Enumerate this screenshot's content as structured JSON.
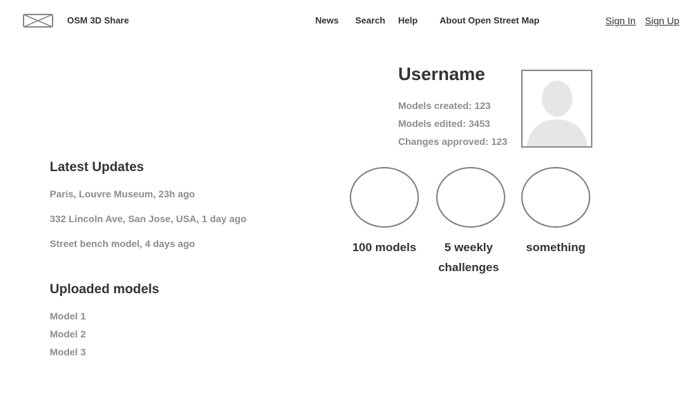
{
  "header": {
    "brand": "OSM 3D Share",
    "logo_icon": "image-placeholder-icon",
    "nav": [
      "News",
      "Search",
      "Help",
      "About Open Street Map"
    ],
    "sign_in": "Sign In",
    "sign_up": "Sign Up"
  },
  "profile": {
    "username": "Username",
    "stats": [
      "Models created: 123",
      "Models edited: 3453",
      "Changes approved: 123"
    ],
    "avatar_icon": "user-avatar-icon"
  },
  "badges": [
    {
      "label": "100 models"
    },
    {
      "label": "5 weekly challenges"
    },
    {
      "label": "something"
    }
  ],
  "latest_updates": {
    "title": "Latest Updates",
    "items": [
      "Paris, Louvre Museum, 23h ago",
      "332 Lincoln Ave, San Jose, USA, 1 day ago",
      "Street bench model, 4 days ago"
    ]
  },
  "uploaded_models": {
    "title": "Uploaded models",
    "items": [
      "Model 1",
      "Model 2",
      "Model 3"
    ]
  }
}
